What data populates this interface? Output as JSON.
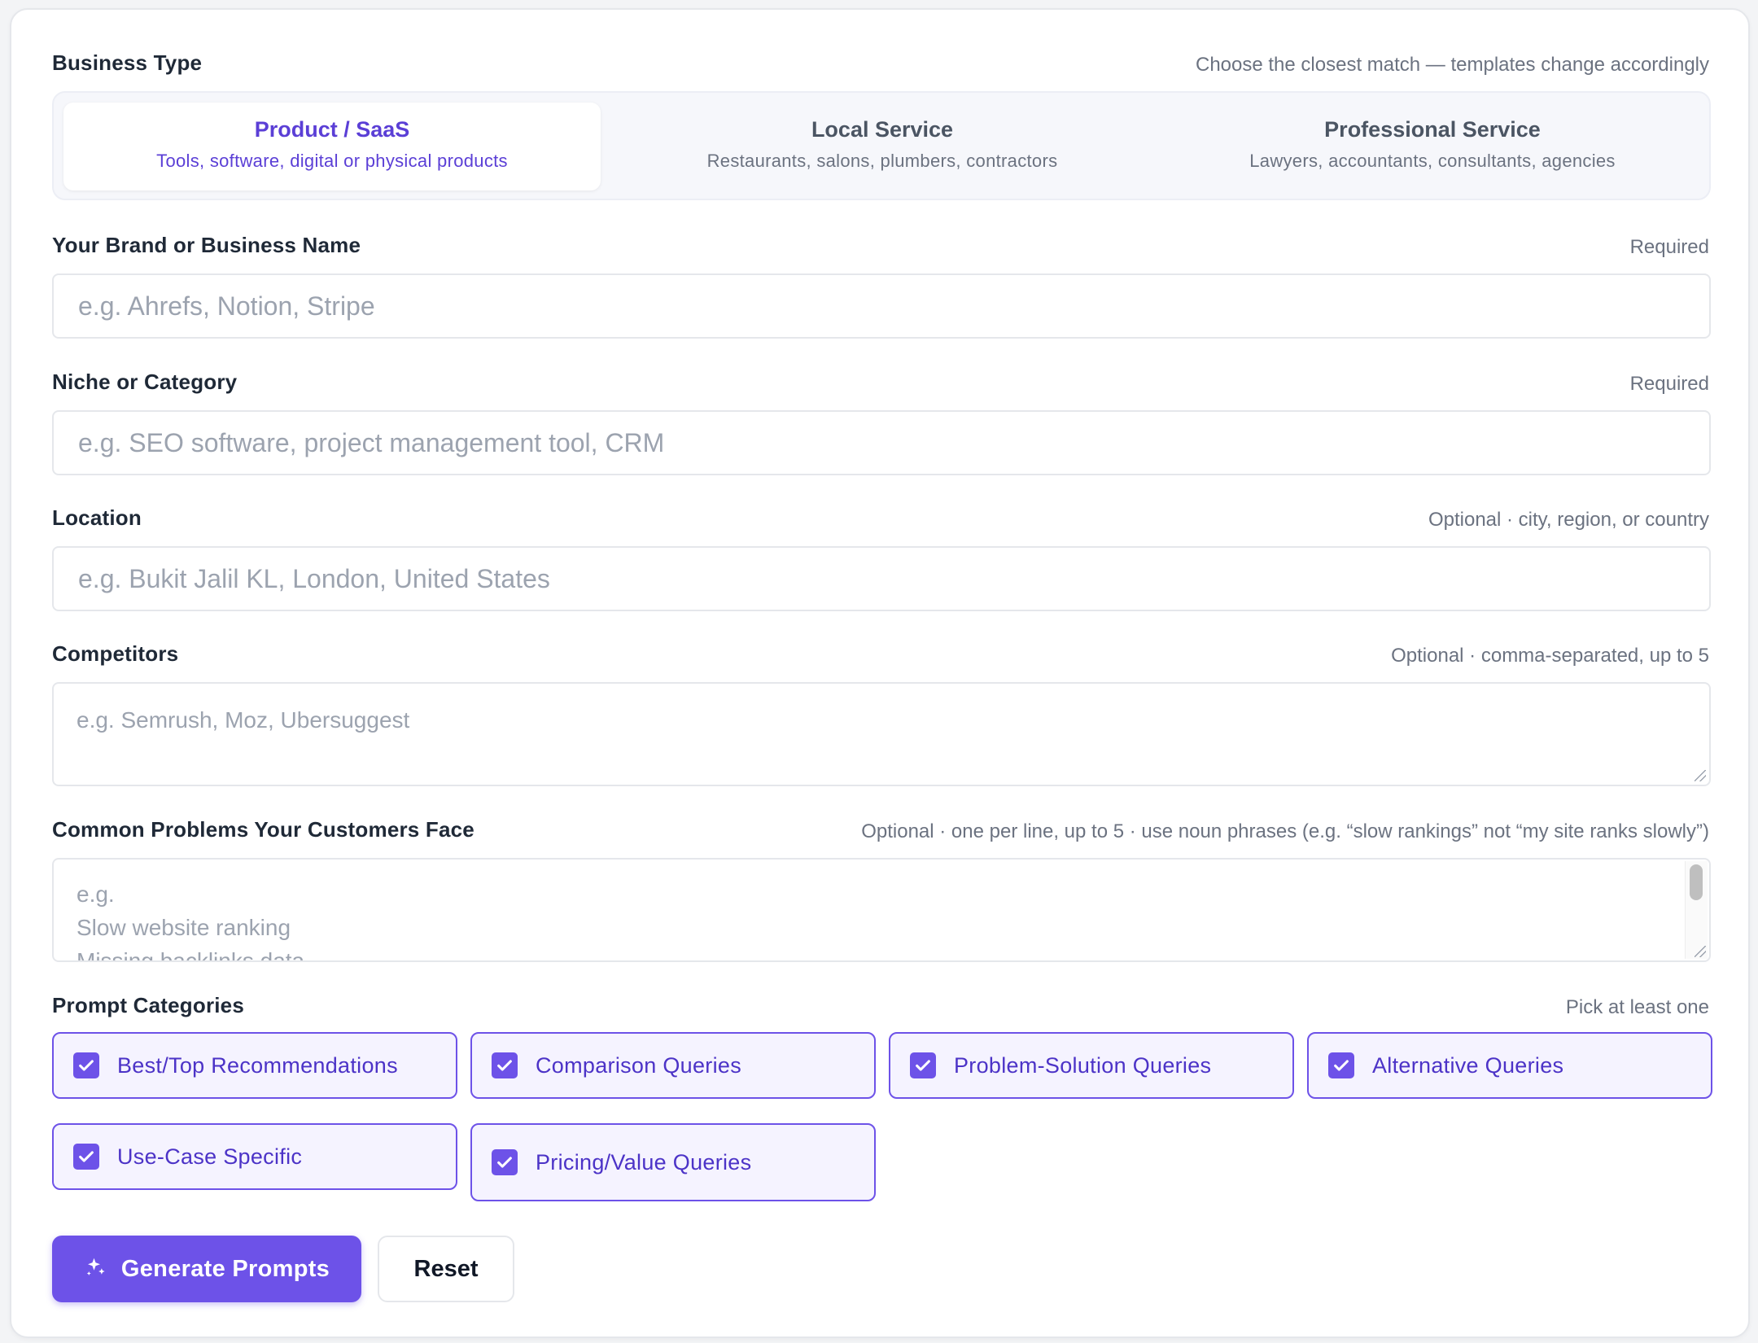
{
  "business_type": {
    "label": "Business Type",
    "hint": "Choose the closest match — templates change accordingly",
    "options": [
      {
        "title": "Product / SaaS",
        "subtitle": "Tools, software, digital or physical products",
        "selected": true
      },
      {
        "title": "Local Service",
        "subtitle": "Restaurants, salons, plumbers, contractors",
        "selected": false
      },
      {
        "title": "Professional Service",
        "subtitle": "Lawyers, accountants, consultants, agencies",
        "selected": false
      }
    ]
  },
  "brand": {
    "label": "Your Brand or Business Name",
    "hint": "Required",
    "placeholder": "e.g. Ahrefs, Notion, Stripe",
    "value": ""
  },
  "niche": {
    "label": "Niche or Category",
    "hint": "Required",
    "placeholder": "e.g. SEO software, project management tool, CRM",
    "value": ""
  },
  "location": {
    "label": "Location",
    "hint": "Optional · city, region, or country",
    "placeholder": "e.g. Bukit Jalil KL, London, United States",
    "value": ""
  },
  "competitors": {
    "label": "Competitors",
    "hint": "Optional · comma-separated, up to 5",
    "placeholder": "e.g. Semrush, Moz, Ubersuggest"
  },
  "problems": {
    "label": "Common Problems Your Customers Face",
    "hint": "Optional · one per line, up to 5 · use noun phrases (e.g. “slow rankings” not “my site ranks slowly”)",
    "placeholder_lines": [
      "e.g.",
      "Slow website ranking",
      "Missing backlinks data"
    ]
  },
  "prompt_categories": {
    "label": "Prompt Categories",
    "hint": "Pick at least one",
    "items": [
      {
        "label": "Best/Top Recommendations",
        "checked": true
      },
      {
        "label": "Comparison Queries",
        "checked": true
      },
      {
        "label": "Problem-Solution Queries",
        "checked": true
      },
      {
        "label": "Alternative Queries",
        "checked": true
      },
      {
        "label": "Use-Case Specific",
        "checked": true
      },
      {
        "label": "Pricing/Value Queries",
        "checked": true
      }
    ]
  },
  "actions": {
    "generate_label": "Generate Prompts",
    "generate_icon": "sparkle-icon",
    "reset_label": "Reset"
  },
  "colors": {
    "accent": "#6d52e8",
    "accent_text": "#4c33c7",
    "chip_bg": "#f5f3ff"
  }
}
